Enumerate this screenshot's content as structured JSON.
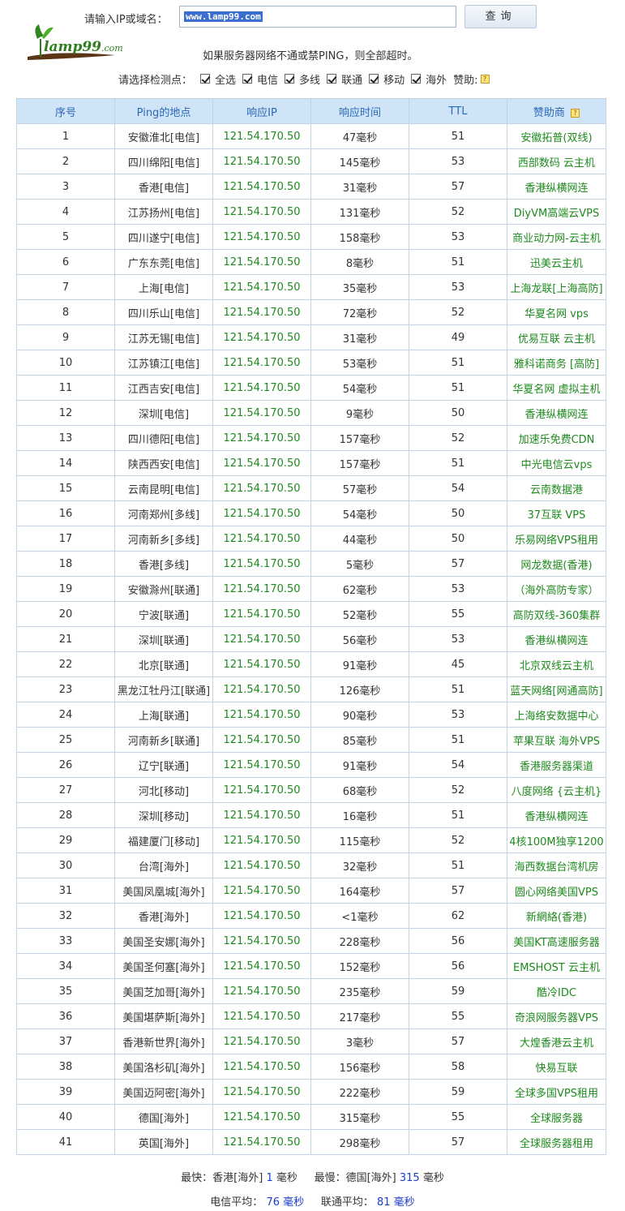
{
  "query": {
    "label": "请输入IP或域名：",
    "value": "www.lamp99.com",
    "button": "查询"
  },
  "logo": {
    "main": "lamp99",
    "suffix": ".com"
  },
  "notice": "如果服务器网络不通或禁PING，则全部超时。",
  "nodes": {
    "label": "请选择检测点：",
    "options": [
      "全选",
      "电信",
      "多线",
      "联通",
      "移动",
      "海外"
    ],
    "sponsor_label": "赞助:"
  },
  "table": {
    "headers": [
      "序号",
      "Ping的地点",
      "响应IP",
      "响应时间",
      "TTL",
      "赞助商"
    ],
    "rows": [
      [
        "1",
        "安徽淮北[电信]",
        "121.54.170.50",
        "47毫秒",
        "51",
        "安徽拓普(双线)"
      ],
      [
        "2",
        "四川绵阳[电信]",
        "121.54.170.50",
        "145毫秒",
        "53",
        "西部数码 云主机"
      ],
      [
        "3",
        "香港[电信]",
        "121.54.170.50",
        "31毫秒",
        "57",
        "香港纵横网连"
      ],
      [
        "4",
        "江苏扬州[电信]",
        "121.54.170.50",
        "131毫秒",
        "52",
        "DiyVM高端云VPS"
      ],
      [
        "5",
        "四川遂宁[电信]",
        "121.54.170.50",
        "158毫秒",
        "53",
        "商业动力网-云主机"
      ],
      [
        "6",
        "广东东莞[电信]",
        "121.54.170.50",
        "8毫秒",
        "51",
        "迅美云主机"
      ],
      [
        "7",
        "上海[电信]",
        "121.54.170.50",
        "35毫秒",
        "53",
        "上海龙联[上海高防]"
      ],
      [
        "8",
        "四川乐山[电信]",
        "121.54.170.50",
        "72毫秒",
        "52",
        "华夏名网 vps"
      ],
      [
        "9",
        "江苏无锡[电信]",
        "121.54.170.50",
        "31毫秒",
        "49",
        "优易互联 云主机"
      ],
      [
        "10",
        "江苏镇江[电信]",
        "121.54.170.50",
        "53毫秒",
        "51",
        "雅科诺商务 [高防]"
      ],
      [
        "11",
        "江西吉安[电信]",
        "121.54.170.50",
        "54毫秒",
        "51",
        "华夏名网 虚拟主机"
      ],
      [
        "12",
        "深圳[电信]",
        "121.54.170.50",
        "9毫秒",
        "50",
        "香港纵横网连"
      ],
      [
        "13",
        "四川德阳[电信]",
        "121.54.170.50",
        "157毫秒",
        "52",
        "加速乐免费CDN"
      ],
      [
        "14",
        "陕西西安[电信]",
        "121.54.170.50",
        "157毫秒",
        "51",
        "中光电信云vps"
      ],
      [
        "15",
        "云南昆明[电信]",
        "121.54.170.50",
        "57毫秒",
        "54",
        "云南数据港"
      ],
      [
        "16",
        "河南郑州[多线]",
        "121.54.170.50",
        "54毫秒",
        "50",
        "37互联 VPS"
      ],
      [
        "17",
        "河南新乡[多线]",
        "121.54.170.50",
        "44毫秒",
        "50",
        "乐易网络VPS租用"
      ],
      [
        "18",
        "香港[多线]",
        "121.54.170.50",
        "5毫秒",
        "57",
        "网龙数据(香港)"
      ],
      [
        "19",
        "安徽滁州[联通]",
        "121.54.170.50",
        "62毫秒",
        "53",
        "（海外高防专家）"
      ],
      [
        "20",
        "宁波[联通]",
        "121.54.170.50",
        "52毫秒",
        "55",
        "高防双线-360集群"
      ],
      [
        "21",
        "深圳[联通]",
        "121.54.170.50",
        "56毫秒",
        "53",
        "香港纵横网连"
      ],
      [
        "22",
        "北京[联通]",
        "121.54.170.50",
        "91毫秒",
        "45",
        "北京双线云主机"
      ],
      [
        "23",
        "黑龙江牡丹江[联通]",
        "121.54.170.50",
        "126毫秒",
        "51",
        "蓝天网络[网通高防]"
      ],
      [
        "24",
        "上海[联通]",
        "121.54.170.50",
        "90毫秒",
        "53",
        "上海络安数据中心"
      ],
      [
        "25",
        "河南新乡[联通]",
        "121.54.170.50",
        "85毫秒",
        "51",
        "苹果互联 海外VPS"
      ],
      [
        "26",
        "辽宁[联通]",
        "121.54.170.50",
        "91毫秒",
        "54",
        "香港服务器渠道"
      ],
      [
        "27",
        "河北[移动]",
        "121.54.170.50",
        "68毫秒",
        "52",
        "八度网络 {云主机}"
      ],
      [
        "28",
        "深圳[移动]",
        "121.54.170.50",
        "16毫秒",
        "51",
        "香港纵横网连"
      ],
      [
        "29",
        "福建厦门[移动]",
        "121.54.170.50",
        "115毫秒",
        "52",
        "4核100M独享1200"
      ],
      [
        "30",
        "台湾[海外]",
        "121.54.170.50",
        "32毫秒",
        "51",
        "海西数据台湾机房"
      ],
      [
        "31",
        "美国凤凰城[海外]",
        "121.54.170.50",
        "164毫秒",
        "57",
        "圆心网络美国VPS"
      ],
      [
        "32",
        "香港[海外]",
        "121.54.170.50",
        "<1毫秒",
        "62",
        "新網絡(香港)"
      ],
      [
        "33",
        "美国圣安娜[海外]",
        "121.54.170.50",
        "228毫秒",
        "56",
        "美国KT高速服务器"
      ],
      [
        "34",
        "美国圣何塞[海外]",
        "121.54.170.50",
        "152毫秒",
        "56",
        "EMSHOST 云主机"
      ],
      [
        "35",
        "美国芝加哥[海外]",
        "121.54.170.50",
        "235毫秒",
        "59",
        "酷冷IDC"
      ],
      [
        "36",
        "美国堪萨斯[海外]",
        "121.54.170.50",
        "217毫秒",
        "55",
        "奇浪网服务器VPS"
      ],
      [
        "37",
        "香港新世界[海外]",
        "121.54.170.50",
        "3毫秒",
        "57",
        "大煌香港云主机"
      ],
      [
        "38",
        "美国洛杉矶[海外]",
        "121.54.170.50",
        "156毫秒",
        "58",
        "快易互联"
      ],
      [
        "39",
        "美国迈阿密[海外]",
        "121.54.170.50",
        "222毫秒",
        "59",
        "全球多国VPS租用"
      ],
      [
        "40",
        "德国[海外]",
        "121.54.170.50",
        "315毫秒",
        "55",
        "全球服务器"
      ],
      [
        "41",
        "英国[海外]",
        "121.54.170.50",
        "298毫秒",
        "57",
        "全球服务器租用"
      ]
    ],
    "slow_rows": [
      33,
      35,
      36,
      39,
      40,
      41
    ]
  },
  "summary": {
    "fastest_label": "最快：香港[海外]",
    "fastest_value": "1",
    "slowest_label": "最慢：德国[海外]",
    "slowest_value": "315",
    "unit": "毫秒",
    "telecom_label": "电信平均：",
    "telecom_value": "76",
    "unicom_label": "联通平均：",
    "unicom_value": "81"
  },
  "colors": {
    "header_bg": "#cfe4f6",
    "header_text": "#2a68b8",
    "ip": "#1e8a1e",
    "slow": "#e01818",
    "number": "#1a3ccc"
  }
}
